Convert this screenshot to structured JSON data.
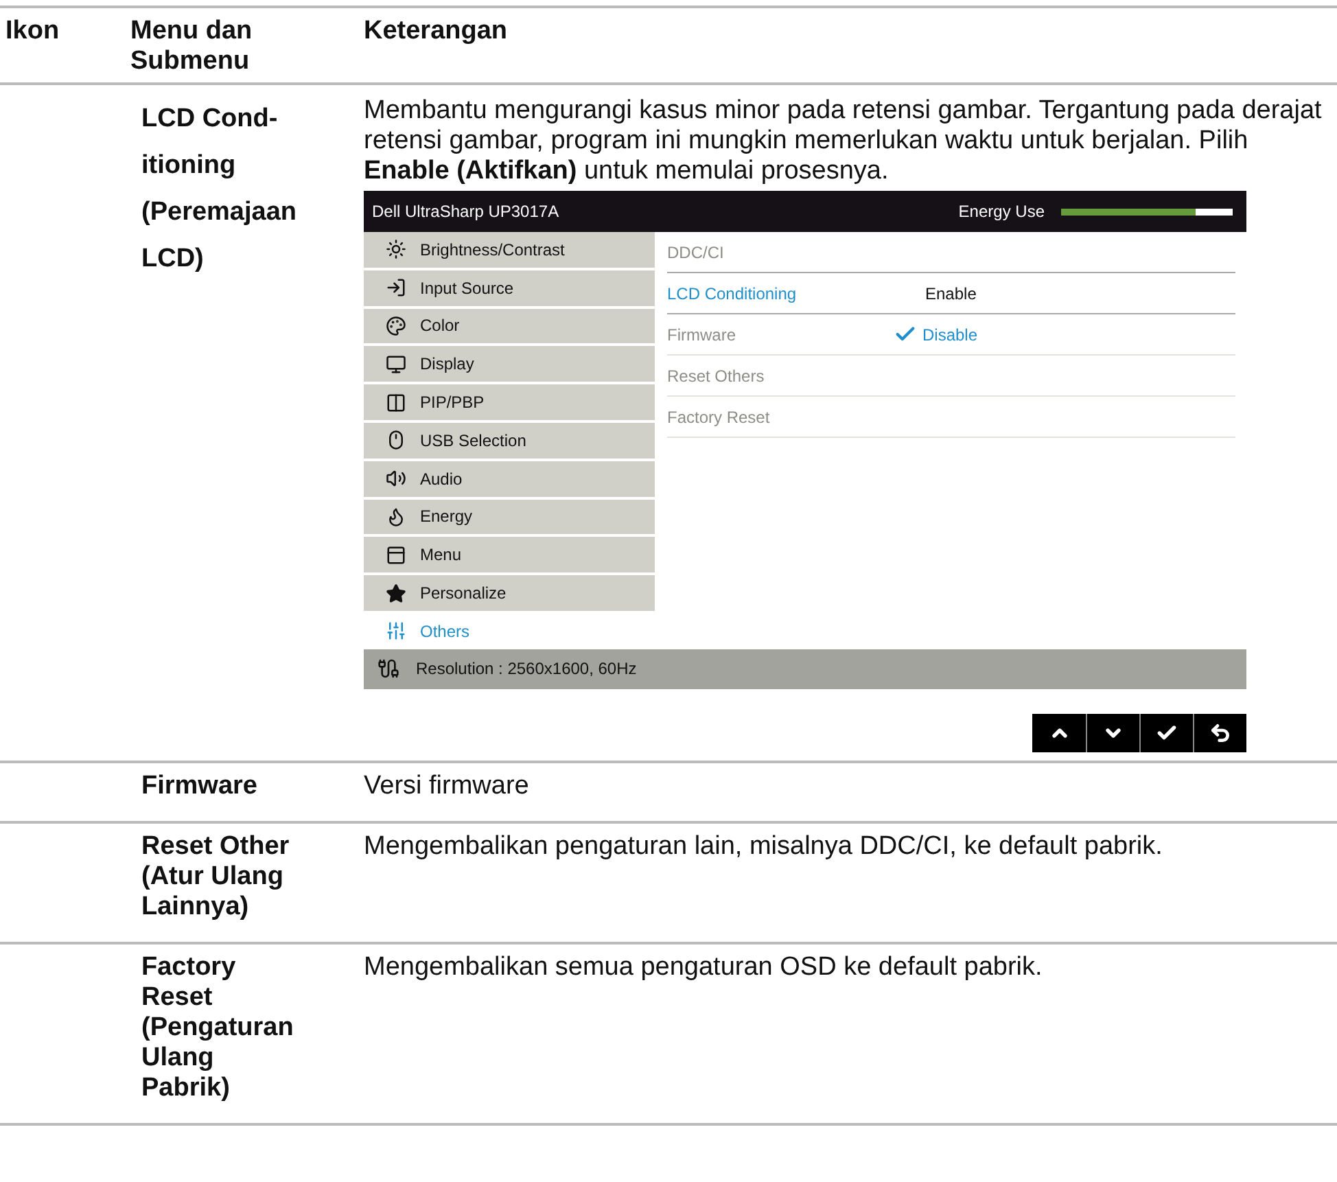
{
  "columns": [
    "Ikon",
    "Menu dan Submenu",
    "Keterangan"
  ],
  "rows": [
    {
      "menu": [
        "LCD Cond-",
        "itioning",
        "(Peremajaan",
        "LCD)"
      ],
      "description": "Membantu mengurangi kasus minor pada retensi gambar. Tergantung pada derajat retensi gambar, program ini mungkin memerlukan waktu untuk berjalan. Pilih **Enable (Aktifkan)** untuk memulai prosesnya.",
      "osd": {
        "title": "Dell UltraSharp UP3017A",
        "energy_label": "Energy Use",
        "energy": {
          "level": 0.78
        },
        "menu": [
          {
            "label": "Brightness/Contrast",
            "selected": false
          },
          {
            "label": "Input Source",
            "selected": false
          },
          {
            "label": "Color",
            "selected": false
          },
          {
            "label": "Display",
            "selected": false
          },
          {
            "label": "PIP/PBP",
            "selected": false
          },
          {
            "label": "USB Selection",
            "selected": false
          },
          {
            "label": "Audio",
            "selected": false
          },
          {
            "label": "Energy",
            "selected": false
          },
          {
            "label": "Menu",
            "selected": false
          },
          {
            "label": "Personalize",
            "selected": false
          },
          {
            "label": "Others",
            "selected": true
          }
        ],
        "submenu": [
          {
            "label": "DDC/CI",
            "selected": false
          },
          {
            "label": "LCD Conditioning",
            "selected": true
          },
          {
            "label": "Firmware",
            "selected": false
          },
          {
            "label": "Reset Others",
            "selected": false
          },
          {
            "label": "Factory Reset",
            "selected": false
          }
        ],
        "options": [
          {
            "label": "Enable",
            "checked": false
          },
          {
            "label": "Disable",
            "checked": true
          }
        ],
        "status": "Resolution : 2560x1600, 60Hz"
      }
    },
    {
      "menu": [
        "Firmware"
      ],
      "description": "Versi firmware"
    },
    {
      "menu": [
        "Reset Other",
        "(Atur Ulang",
        "Lainnya)"
      ],
      "description": "Mengembalikan pengaturan lain, misalnya DDC/CI, ke default pabrik."
    },
    {
      "menu": [
        "Factory",
        "Reset",
        "(Pengaturan",
        "Ulang",
        "Pabrik)"
      ],
      "description": "Mengembalikan semua pengaturan OSD ke default pabrik."
    }
  ]
}
